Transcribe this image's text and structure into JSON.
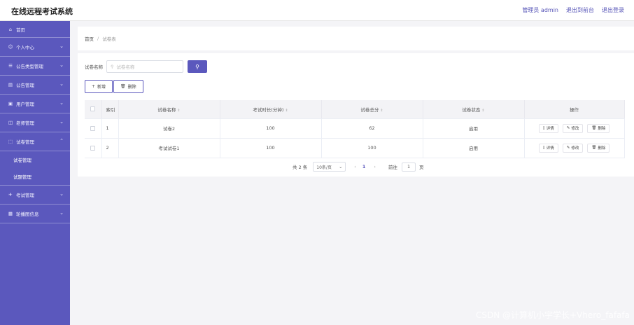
{
  "header": {
    "app_title": "在线远程考试系统",
    "user_label": "管理员 admin",
    "front_link": "退出到前台",
    "logout_link": "退出登录"
  },
  "sidebar": {
    "home": "首页",
    "items": [
      {
        "label": "个人中心",
        "icon": "user-icon"
      },
      {
        "label": "公告类型管理",
        "icon": "list-icon"
      },
      {
        "label": "公告管理",
        "icon": "notice-icon"
      },
      {
        "label": "用户管理",
        "icon": "users-icon"
      },
      {
        "label": "老师管理",
        "icon": "teacher-icon"
      },
      {
        "label": "试卷管理",
        "icon": "paper-icon"
      }
    ],
    "submenu": [
      "试卷管理",
      "试题管理"
    ],
    "items_after": [
      {
        "label": "考试管理",
        "icon": "exam-icon"
      },
      {
        "label": "轮播图信息",
        "icon": "image-icon"
      }
    ]
  },
  "breadcrumb": {
    "home": "首页",
    "separator": "/",
    "current": "试卷表"
  },
  "search": {
    "label": "试卷名称",
    "placeholder": "试卷名称"
  },
  "toolbar": {
    "add_label": "新增",
    "delete_label": "删除"
  },
  "table": {
    "headers": [
      "索引",
      "试卷名称",
      "考试时长(分钟)",
      "试卷总分",
      "试卷状态",
      "操作"
    ],
    "rows": [
      {
        "index": "1",
        "name": "试卷2",
        "duration": "100",
        "score": "62",
        "status": "启用"
      },
      {
        "index": "2",
        "name": "考试试卷1",
        "duration": "100",
        "score": "100",
        "status": "启用"
      }
    ],
    "actions": {
      "detail": "详情",
      "edit": "修改",
      "delete": "删除"
    }
  },
  "pagination": {
    "total_text": "共 2 条",
    "page_size": "10条/页",
    "current_page": "1",
    "goto_label": "前往",
    "goto_value": "1",
    "page_word": "页"
  },
  "watermark": "CSDN @计算机小宇学长+Vhero_fafafa",
  "colors": {
    "accent": "#5b58bd",
    "background": "#f4f4f7"
  }
}
